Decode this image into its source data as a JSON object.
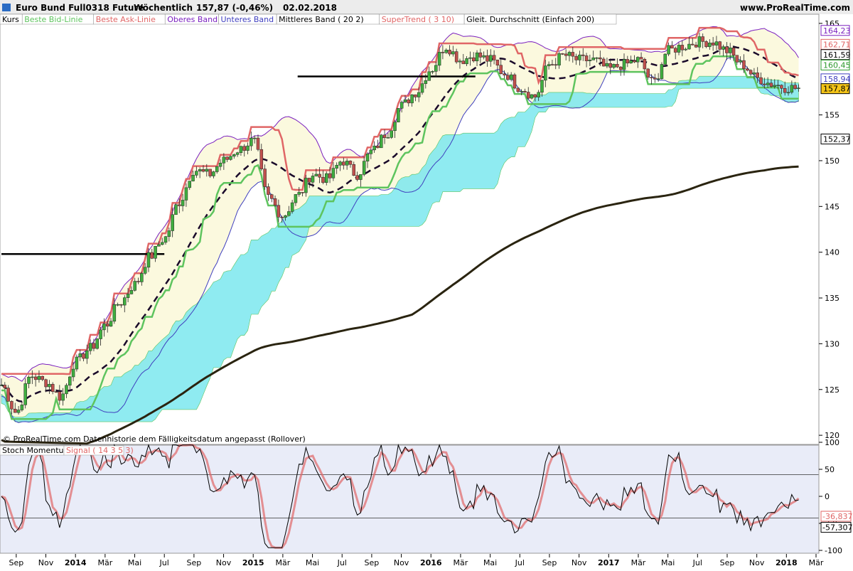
{
  "header": {
    "instrument": "Euro Bund Full0318 Future",
    "period": "Wöchentlich",
    "last_price": "157,87 (-0,46%)",
    "date": "02.02.2018",
    "site": "www.ProRealTime.com"
  },
  "legend": {
    "items": [
      {
        "label": "Kurs",
        "color": "#000000"
      },
      {
        "label": "Beste Bid-Linie",
        "color": "#5ec45e"
      },
      {
        "label": "Beste Ask-Linie",
        "color": "#e06666"
      },
      {
        "label": "Oberes Band",
        "color": "#7a1fbf"
      },
      {
        "label": "Unteres Band",
        "color": "#3f3fbf"
      },
      {
        "label": "Mittleres Band ( 20 2)",
        "color": "#000000"
      },
      {
        "label": "SuperTrend ( 3 10)",
        "color": "#e06666"
      },
      {
        "label": "Gleit. Durchschnitt (Einfach 200)",
        "color": "#000000"
      }
    ]
  },
  "footer_note": "© ProRealTime.com  Datenhistorie dem Fälligkeitsdatum angepasst (Rollover)",
  "price_axis": {
    "ticks": [
      "165",
      "155",
      "150",
      "145",
      "140",
      "135",
      "130",
      "125",
      "120"
    ],
    "badges": [
      {
        "text": "164,23",
        "bg": "#ffffff",
        "fg": "#7a1fbf"
      },
      {
        "text": "162,71",
        "bg": "#ffffff",
        "fg": "#e06666"
      },
      {
        "text": "161,59",
        "bg": "#ffffff",
        "fg": "#000000"
      },
      {
        "text": "160,45",
        "bg": "#ffffff",
        "fg": "#2e9a2e"
      },
      {
        "text": "158,94",
        "bg": "#ffffff",
        "fg": "#3f3fbf"
      },
      {
        "text": "157,87",
        "bg": "#f5c518",
        "fg": "#000000"
      },
      {
        "text": "152,37",
        "bg": "#ffffff",
        "fg": "#000000"
      }
    ]
  },
  "indicator": {
    "title": "Stoch Momentum",
    "signal_label": "Signal ( 14 3 5 3)",
    "ticks": [
      "100",
      "50",
      "0",
      "-50",
      "-100"
    ],
    "badges": [
      {
        "text": "-36,837",
        "fg": "#e06666"
      },
      {
        "text": "-57,307",
        "fg": "#000000"
      }
    ]
  },
  "time_axis": {
    "labels": [
      "Sep",
      "Nov",
      "2014",
      "Mär",
      "Mai",
      "Jul",
      "Sep",
      "Nov",
      "2015",
      "Mär",
      "Mai",
      "Jul",
      "Sep",
      "Nov",
      "2016",
      "Mär",
      "Mai",
      "Jul",
      "Sep",
      "Nov",
      "2017",
      "Mär",
      "Mai",
      "Jul",
      "Sep",
      "Nov",
      "2018",
      "Mär"
    ],
    "bold": [
      "2014",
      "2015",
      "2016",
      "2017",
      "2018"
    ]
  },
  "colors": {
    "up_candle": "#3fae3f",
    "down_candle": "#c0504d",
    "bollinger_fill": "#fbf9de",
    "cloud": "#7be8ef",
    "cloud_green": "#7de87d",
    "ma200": "#2a2410",
    "upper_band": "#7a1fbf",
    "supertrend": "#e06666",
    "bid_line": "#5ec45e",
    "momentum_line": "#3f3fbf",
    "signal_line": "#e06666"
  },
  "chart_data": [
    {
      "type": "candlestick",
      "title": "Euro Bund Full0318 Future",
      "ylim": [
        119,
        166
      ],
      "x_range": [
        "2013-08",
        "2018-03"
      ],
      "price_series": {
        "name": "Kurs",
        "x": [
          "2013-08",
          "2013-09",
          "2013-10",
          "2013-11",
          "2013-12",
          "2014-01",
          "2014-02",
          "2014-03",
          "2014-04",
          "2014-05",
          "2014-06",
          "2014-07",
          "2014-08",
          "2014-09",
          "2014-10",
          "2014-11",
          "2014-12",
          "2015-01",
          "2015-02",
          "2015-03",
          "2015-04",
          "2015-05",
          "2015-06",
          "2015-07",
          "2015-08",
          "2015-09",
          "2015-10",
          "2015-11",
          "2015-12",
          "2016-01",
          "2016-02",
          "2016-03",
          "2016-04",
          "2016-05",
          "2016-06",
          "2016-07",
          "2016-08",
          "2016-09",
          "2016-10",
          "2016-11",
          "2016-12",
          "2017-01",
          "2017-02",
          "2017-03",
          "2017-04",
          "2017-05",
          "2017-06",
          "2017-07",
          "2017-08",
          "2017-09",
          "2017-10",
          "2017-11",
          "2017-12",
          "2018-01",
          "2018-02"
        ],
        "y": [
          125.5,
          122.5,
          126.5,
          125.8,
          124.2,
          128.0,
          129.5,
          132.0,
          134.5,
          136.5,
          139.5,
          141.5,
          145.5,
          149.0,
          148.5,
          150.0,
          151.2,
          152.2,
          146.0,
          144.0,
          146.2,
          148.5,
          148.0,
          150.0,
          148.5,
          151.0,
          153.0,
          156.0,
          157.5,
          160.0,
          162.5,
          161.0,
          161.5,
          161.0,
          159.5,
          158.0,
          157.0,
          160.5,
          161.5,
          161.0,
          161.0,
          160.0,
          160.5,
          161.0,
          158.5,
          162.0,
          162.5,
          163.0,
          163.0,
          162.0,
          160.5,
          159.0,
          158.4,
          158.0,
          157.87
        ]
      },
      "series": [
        {
          "name": "Oberes Band",
          "last": 164.23
        },
        {
          "name": "Beste Ask-Linie",
          "last": 162.71
        },
        {
          "name": "Mittleres Band ( 20 2)",
          "last": 161.59
        },
        {
          "name": "Beste Bid-Linie",
          "last": 160.45
        },
        {
          "name": "Unteres Band",
          "last": 158.94
        },
        {
          "name": "Gleit. Durchschnitt (Einfach 200)",
          "last": 152.37
        }
      ],
      "horizontal_lines": [
        {
          "y": 139.8,
          "from": "2013-08",
          "to": "2014-07"
        },
        {
          "y": 159.2,
          "from": "2015-04",
          "to": "2016-04"
        }
      ]
    },
    {
      "type": "line",
      "title": "Stoch Momentum",
      "ylim": [
        -100,
        100
      ],
      "reference_lines": [
        40,
        -40
      ],
      "series": [
        {
          "name": "Stoch Momentum",
          "last": -57.307
        },
        {
          "name": "Signal ( 14 3 5 3)",
          "last": -36.837
        }
      ]
    }
  ]
}
